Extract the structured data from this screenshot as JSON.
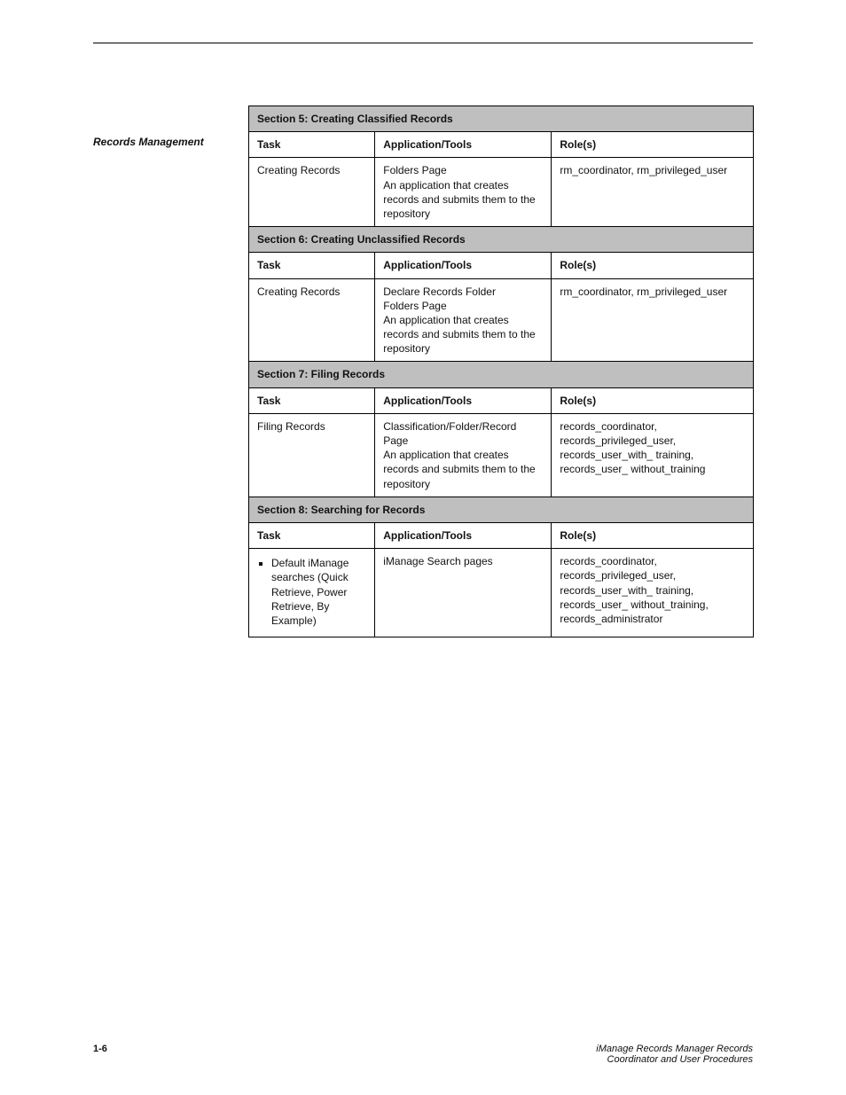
{
  "sidebar": {
    "heading": "Records Management"
  },
  "table": {
    "headers": {
      "task": "Task",
      "appl": "Application/Tools",
      "roles": "Role(s)"
    },
    "sections": [
      {
        "title": "Section 5: Creating Classified Records",
        "rows": [
          {
            "task": "Creating Records",
            "appl": "Folders Page\nAn application that creates records and submits them to the repository",
            "roles": "rm_coordinator, rm_privileged_user"
          }
        ]
      },
      {
        "title": "Section 6: Creating Unclassified Records",
        "rows": [
          {
            "task": "Creating Records",
            "appl": "Declare Records Folder\nFolders Page\nAn application that creates records and submits them to the repository",
            "roles": "rm_coordinator, rm_privileged_user"
          }
        ]
      },
      {
        "title": "Section 7: Filing Records",
        "rows": [
          {
            "task": "Filing Records",
            "appl": "Classification/Folder/Record Page\nAn application that creates records and submits them to the repository",
            "roles": "records_coordinator, records_privileged_user, records_user_with_ training, records_user_ without_training"
          }
        ]
      },
      {
        "title": "Section 8: Searching for Records",
        "rows": [
          {
            "task_bullets": [
              "Default iManage searches (Quick Retrieve, Power Retrieve, By Example)"
            ],
            "appl": "iManage Search pages",
            "roles": "records_coordinator, records_privileged_user, records_user_with_ training, records_user_ without_training, records_administrator"
          }
        ]
      }
    ]
  },
  "footer": {
    "left": "1-6",
    "right_line1": "iManage Records Manager Records",
    "right_line2": "Coordinator and User Procedures"
  }
}
